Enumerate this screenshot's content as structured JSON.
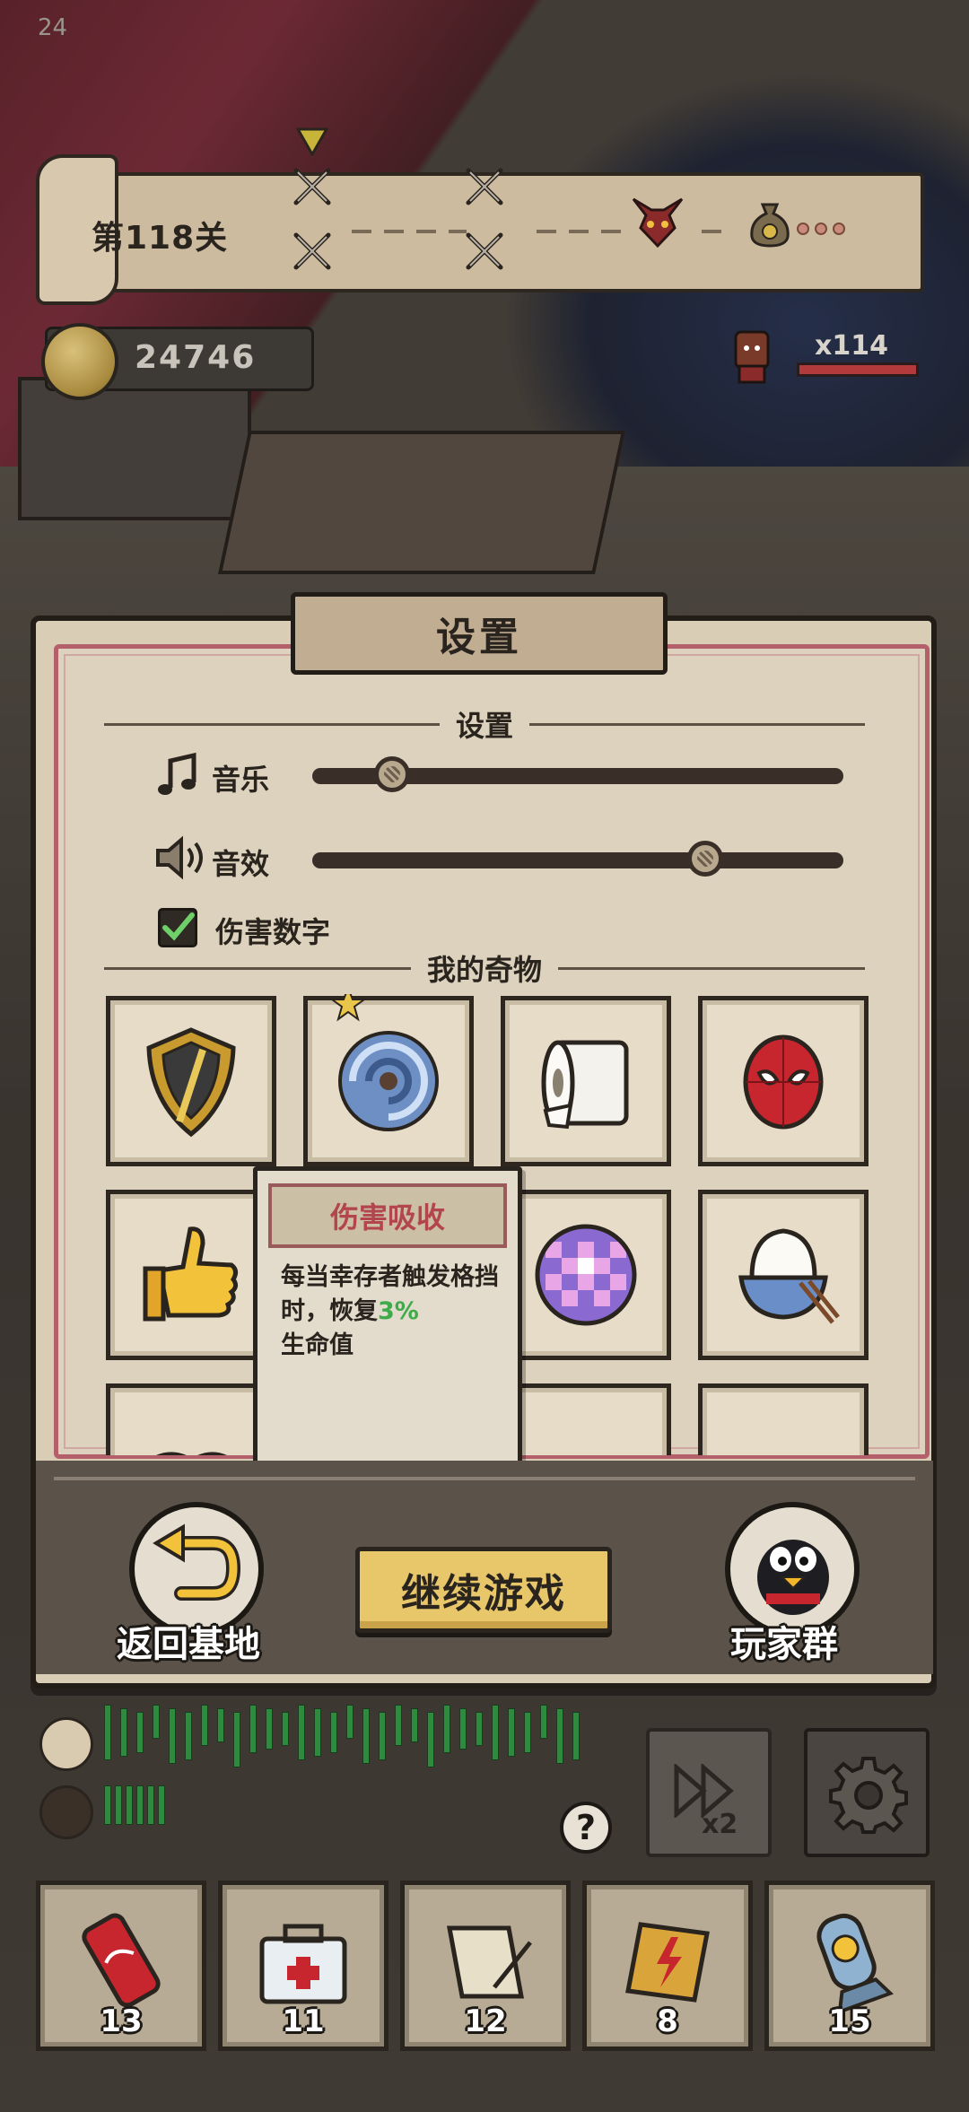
{
  "status": {
    "fps": "24"
  },
  "level": {
    "title": "第118关",
    "stage_icons": [
      "crossed-swords-icon",
      "crossed-swords-icon",
      "crossed-swords-icon",
      "crossed-swords-icon"
    ],
    "boss_icon": "demon-boss-icon",
    "reward_icon": "money-bag-icon"
  },
  "currency": {
    "coins": "24746"
  },
  "enemies": {
    "count": "x114",
    "health_fraction": 1.0
  },
  "settings": {
    "title": "设置",
    "section_settings": "设置",
    "music": {
      "label": "音乐",
      "icon": "music-note-icon",
      "level": 0.15
    },
    "sfx": {
      "label": "音效",
      "icon": "speaker-icon",
      "level": 0.74
    },
    "damage_numbers": {
      "label": "伤害数字",
      "checked": true
    },
    "section_relics": "我的奇物",
    "relics": [
      {
        "name": "shield-relic",
        "icon": "golden-shield-icon",
        "starred": false
      },
      {
        "name": "vortex-relic",
        "icon": "blue-vortex-icon",
        "starred": true
      },
      {
        "name": "toilet-paper-relic",
        "icon": "toilet-paper-icon",
        "starred": false
      },
      {
        "name": "spider-mask-relic",
        "icon": "spider-mask-icon",
        "starred": false
      },
      {
        "name": "thumbs-up-relic",
        "icon": "thumbs-up-icon",
        "starred": false
      },
      {
        "name": "hidden-relic",
        "icon": "",
        "starred": false
      },
      {
        "name": "disco-ball-relic",
        "icon": "disco-ball-icon",
        "starred": false
      },
      {
        "name": "rice-bowl-relic",
        "icon": "rice-bowl-icon",
        "starred": false
      }
    ],
    "tooltip": {
      "title": "伤害吸收",
      "desc_prefix": "每当幸存者触发格挡时，恢复",
      "desc_value": "3%",
      "desc_suffix": "生命值"
    },
    "buttons": {
      "back": "返回基地",
      "continue": "继续游戏",
      "group": "玩家群"
    }
  },
  "hud": {
    "speed_label": "x2",
    "help": "?"
  },
  "items": [
    {
      "name": "cola-can",
      "icon": "cola-can-icon",
      "count": "13"
    },
    {
      "name": "first-aid-kit",
      "icon": "first-aid-kit-icon",
      "count": "11"
    },
    {
      "name": "scroll",
      "icon": "scroll-quill-icon",
      "count": "12"
    },
    {
      "name": "lightning-map",
      "icon": "lightning-map-icon",
      "count": "8"
    },
    {
      "name": "nuke-bomb",
      "icon": "nuke-bomb-icon",
      "count": "15"
    }
  ],
  "colors": {
    "parchment": "#d9cdb6",
    "frame_red": "#b4606a",
    "continue_yellow": "#e8c66a",
    "highlight_green": "#3faa4a",
    "tooltip_title": "#b2454d"
  }
}
